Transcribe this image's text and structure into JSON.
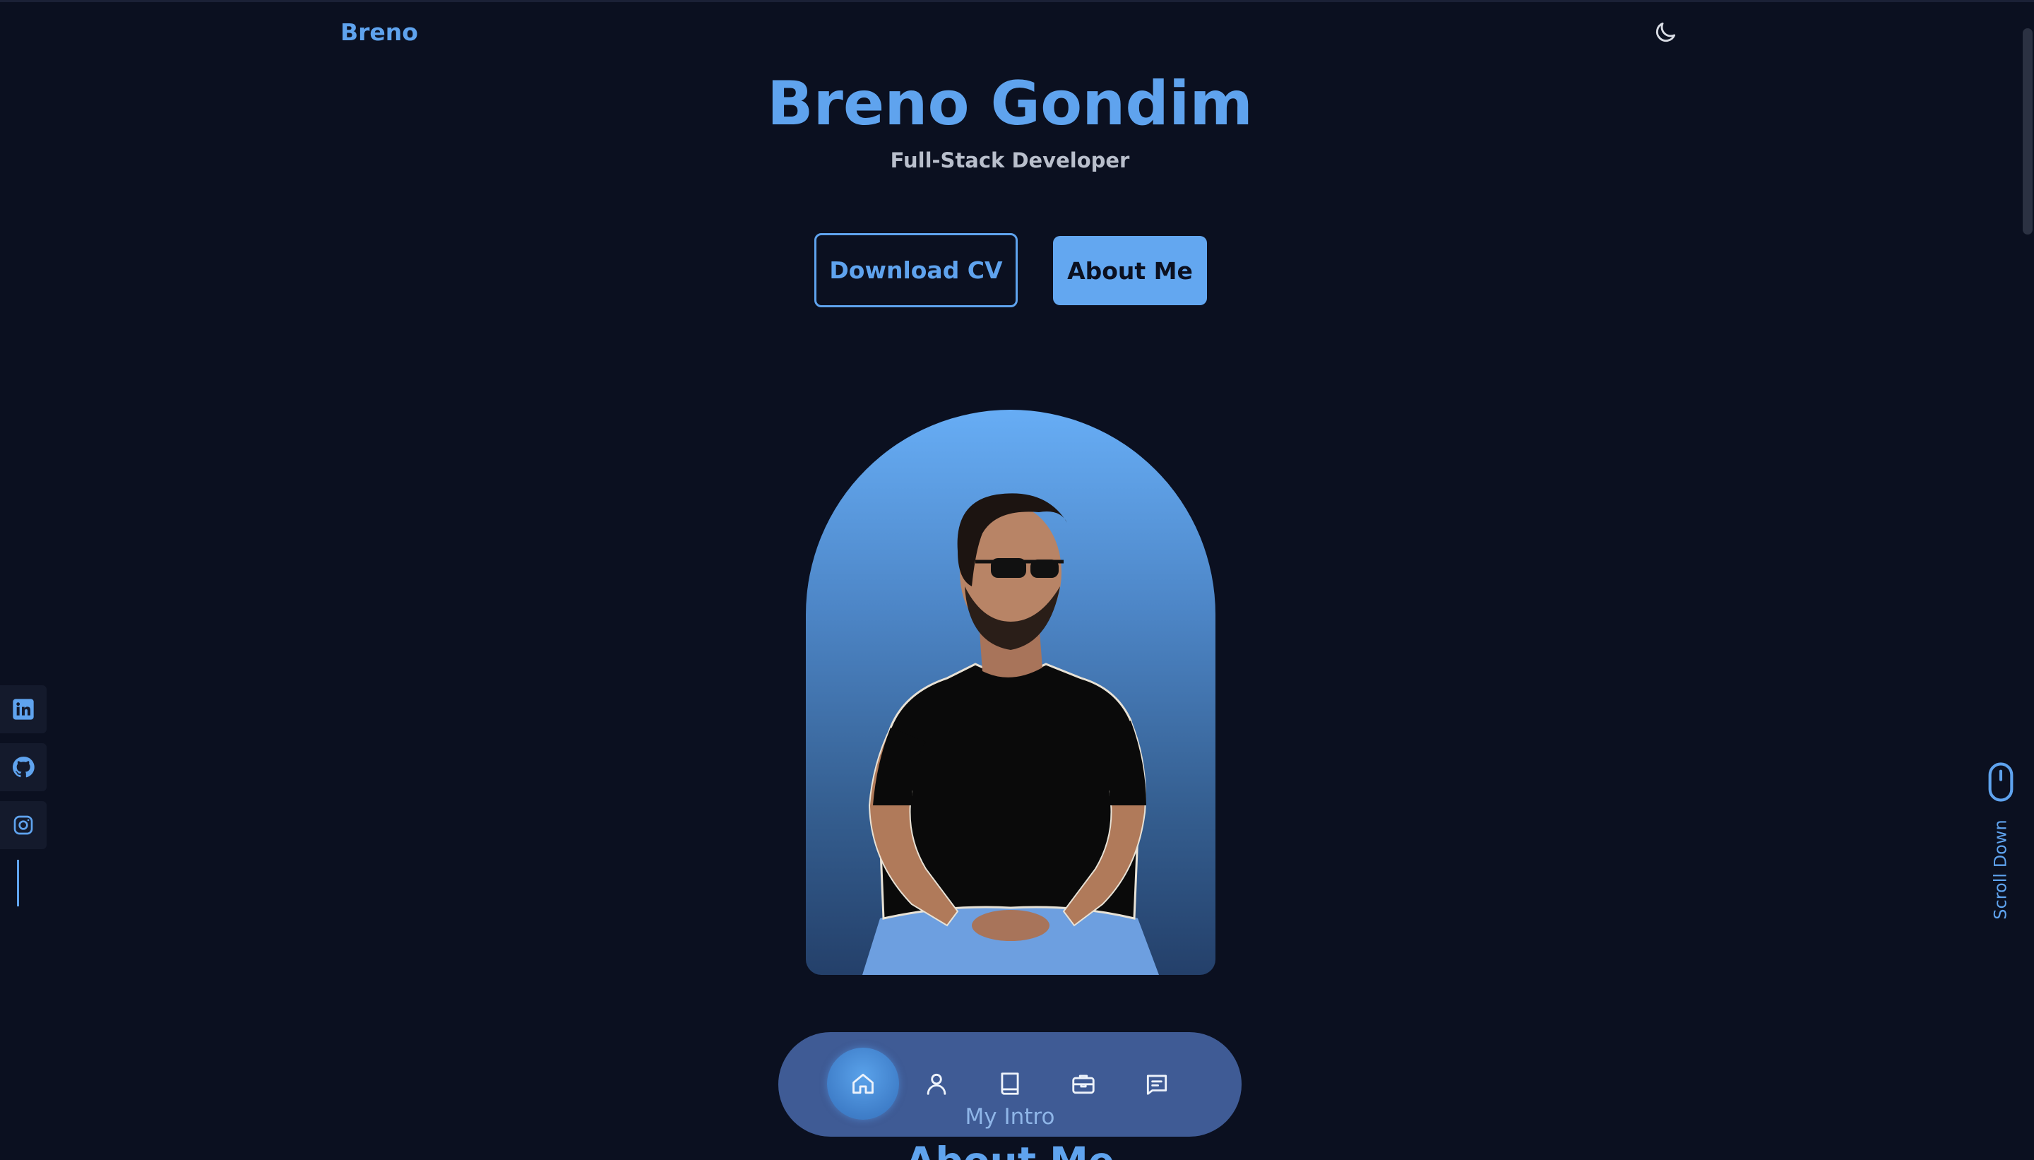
{
  "header": {
    "logo": "Breno",
    "theme_icon": "moon-icon"
  },
  "hero": {
    "name": "Breno Gondim",
    "role": "Full-Stack Developer",
    "download_label": "Download CV",
    "about_label": "About Me"
  },
  "social": {
    "items": [
      {
        "icon": "linkedin-icon"
      },
      {
        "icon": "github-icon"
      },
      {
        "icon": "instagram-icon"
      }
    ]
  },
  "scroll": {
    "label": "Scroll Down",
    "icon": "mouse-icon"
  },
  "bottom_nav": {
    "items": [
      {
        "icon": "home-icon",
        "active": true
      },
      {
        "icon": "user-icon",
        "active": false
      },
      {
        "icon": "book-icon",
        "active": false
      },
      {
        "icon": "briefcase-icon",
        "active": false
      },
      {
        "icon": "message-icon",
        "active": false
      }
    ],
    "caption": "My Intro"
  },
  "next_section": {
    "title": "About Me"
  },
  "colors": {
    "background": "#0b1020",
    "accent": "#5fa3ee",
    "text_muted": "#b9bfcc"
  }
}
